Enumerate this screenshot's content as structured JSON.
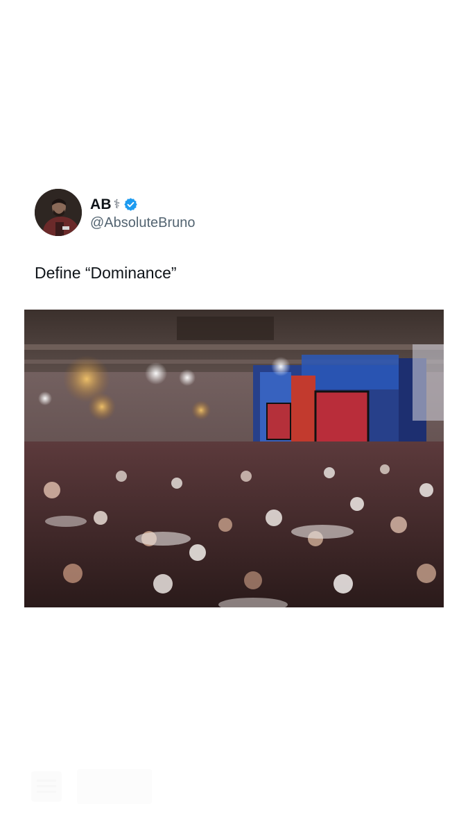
{
  "tweet": {
    "author": {
      "display_name": "AB",
      "name_emoji": "⚕",
      "handle": "@AbsoluteBruno",
      "verified": true,
      "verified_color": "#1d9bf0"
    },
    "text": "Define “Dominance”",
    "media": {
      "type": "photo",
      "subject": "ballroom banquet hall with crowded tables, chandeliers, stage with two red screens and blue lighting"
    }
  },
  "colors": {
    "text_primary": "#0f1419",
    "text_secondary": "#536471",
    "background": "#ffffff"
  },
  "icons": {
    "verified": "verified-badge-icon",
    "bottom_left": "menu-lines-icon"
  }
}
